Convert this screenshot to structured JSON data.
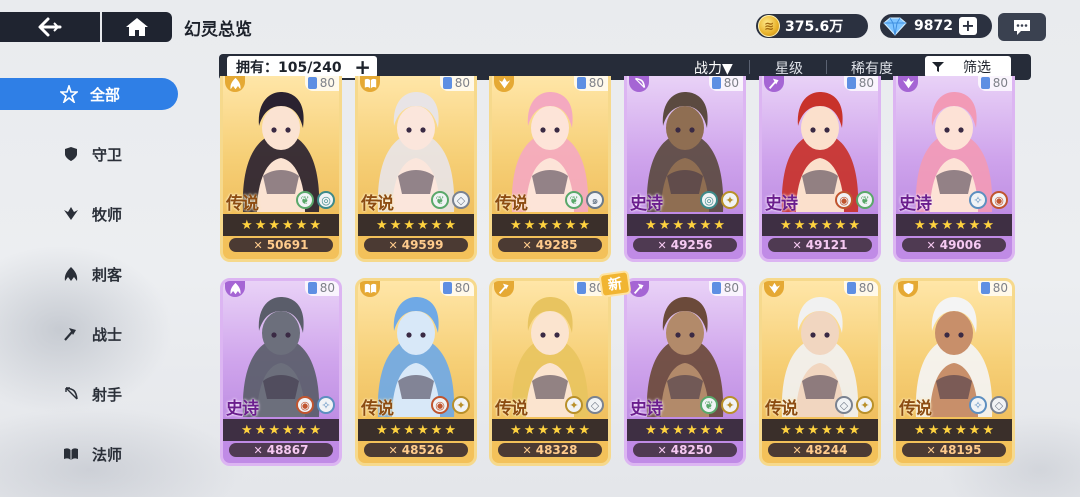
{
  "header": {
    "title": "幻灵总览",
    "gold": "375.6万",
    "gems": "9872",
    "plus": "+"
  },
  "sidebar": {
    "items": [
      {
        "label": "全部",
        "icon": "star-all-icon"
      },
      {
        "label": "守卫",
        "icon": "shield-icon"
      },
      {
        "label": "牧师",
        "icon": "wing-icon"
      },
      {
        "label": "刺客",
        "icon": "claw-icon"
      },
      {
        "label": "战士",
        "icon": "axe-icon"
      },
      {
        "label": "射手",
        "icon": "bow-icon"
      },
      {
        "label": "法师",
        "icon": "book-icon"
      }
    ]
  },
  "filter_bar": {
    "owned": "拥有：105/240",
    "sort_power": "战力▼",
    "sort_star": "星级",
    "sort_rarity": "稀有度",
    "filter": "筛选"
  },
  "new_badge": "新",
  "cards": [
    {
      "rarity": "传说",
      "tier": "legend",
      "level": "80",
      "power": "50691",
      "class_icon": "claw-icon",
      "elements": [
        "leaf",
        "water"
      ]
    },
    {
      "rarity": "传说",
      "tier": "legend",
      "level": "80",
      "power": "49599",
      "class_icon": "book-icon",
      "elements": [
        "leaf",
        "void"
      ]
    },
    {
      "rarity": "传说",
      "tier": "legend",
      "level": "80",
      "power": "49285",
      "class_icon": "wing-icon",
      "elements": [
        "leaf",
        "wind"
      ]
    },
    {
      "rarity": "史诗",
      "tier": "epic",
      "level": "80",
      "power": "49256",
      "class_icon": "bow-icon",
      "elements": [
        "water",
        "wing"
      ]
    },
    {
      "rarity": "史诗",
      "tier": "epic",
      "level": "80",
      "power": "49121",
      "class_icon": "axe-icon",
      "elements": [
        "fire",
        "leaf"
      ]
    },
    {
      "rarity": "史诗",
      "tier": "epic",
      "level": "80",
      "power": "49006",
      "class_icon": "wing-icon",
      "elements": [
        "light",
        "fire"
      ]
    },
    {
      "rarity": "史诗",
      "tier": "epic",
      "level": "80",
      "power": "48867",
      "class_icon": "claw-icon",
      "elements": [
        "fire",
        "light"
      ]
    },
    {
      "rarity": "传说",
      "tier": "legend",
      "level": "80",
      "power": "48526",
      "class_icon": "book-icon",
      "elements": [
        "fire",
        "wing"
      ]
    },
    {
      "rarity": "传说",
      "tier": "legend",
      "level": "80",
      "power": "48328",
      "class_icon": "axe-icon",
      "elements": [
        "wing",
        "void"
      ]
    },
    {
      "rarity": "史诗",
      "tier": "epic",
      "level": "80",
      "power": "48250",
      "class_icon": "axe-icon",
      "elements": [
        "leaf",
        "wing"
      ]
    },
    {
      "rarity": "传说",
      "tier": "legend",
      "level": "80",
      "power": "48244",
      "class_icon": "wing-icon",
      "elements": [
        "void",
        "wing"
      ]
    },
    {
      "rarity": "传说",
      "tier": "legend",
      "level": "80",
      "power": "48195",
      "class_icon": "shield-icon",
      "elements": [
        "light",
        "void"
      ]
    }
  ],
  "stars_per_card": 6,
  "colors": {
    "legend": "#f3c15a",
    "epic": "#c08be6",
    "accent": "#2f7fe6",
    "bar": "#262c39"
  }
}
